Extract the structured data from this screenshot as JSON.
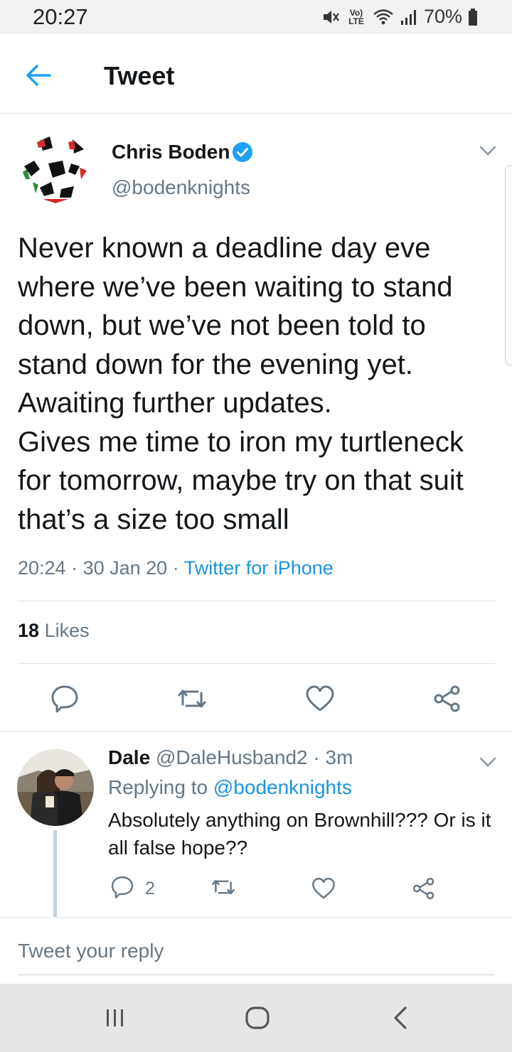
{
  "status_bar": {
    "time": "20:27",
    "network_label": "Vo) LTE",
    "battery": "70%",
    "icons": [
      "mute-icon",
      "wifi-icon",
      "signal-icon",
      "battery-icon"
    ]
  },
  "header": {
    "title": "Tweet",
    "back_icon": "arrow-left-icon"
  },
  "tweet": {
    "author_name": "Chris Boden",
    "author_handle": "@bodenknights",
    "verified": true,
    "text": "Never known a deadline day eve where we’ve been waiting to stand down, but we’ve not been told to stand down for the evening yet. Awaiting further updates.\nGives me time to iron my turtleneck for tomorrow, maybe try on that suit that’s a size too small",
    "time": "20:24",
    "date": "30 Jan 20",
    "source": "Twitter for iPhone",
    "likes_count": "18",
    "likes_label": "Likes"
  },
  "reply": {
    "name": "Dale",
    "handle": "@DaleHusband2",
    "age": "3m",
    "replying_prefix": "Replying to",
    "replying_to": "@bodenknights",
    "text": "Absolutely anything on Brownhill??? Or is it all false hope??",
    "reply_count": "2"
  },
  "compose": {
    "placeholder": "Tweet your reply"
  },
  "colors": {
    "accent": "#1da1f2",
    "link": "#1b95e0",
    "secondary_text": "#657786",
    "divider": "#dde3e8"
  }
}
